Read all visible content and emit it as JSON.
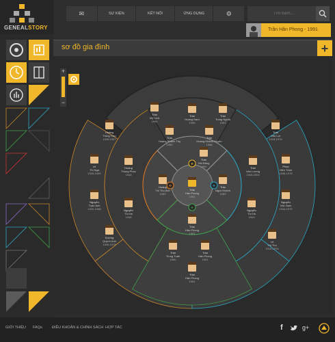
{
  "logo": {
    "part1": "GENEAL",
    "part2": "STORY"
  },
  "nav": {
    "mail_icon": "mail-icon",
    "items": [
      "SỰ KIỆN",
      "KẾT NỐI",
      "ỨNG DỤNG"
    ],
    "settings_icon": "gear-icon"
  },
  "search": {
    "placeholder": "Tìm kiếm..."
  },
  "user": {
    "name": "Trần Hân Phong - 1991"
  },
  "page": {
    "title": "sơ đồ gia đình",
    "add_label": "+"
  },
  "zoom": {
    "plus": "+",
    "minus": "−"
  },
  "tree": {
    "people": [
      {
        "id": "p1",
        "name": "Trần",
        "sub": "Mỹ Linh",
        "years": "1994"
      },
      {
        "id": "p2",
        "name": "Trần",
        "sub": "Hoàng Nam",
        "years": "1990"
      },
      {
        "id": "p3",
        "name": "Trần",
        "sub": "Trọng Nghĩa",
        "years": "1993"
      },
      {
        "id": "p4",
        "name": "Trần",
        "sub": "Hoàng Khánh Thy",
        "years": "1989"
      },
      {
        "id": "p5",
        "name": "Trần",
        "sub": "Hoàng Khánh Huyền",
        "years": "1988"
      },
      {
        "id": "p6",
        "name": "Trần",
        "sub": "Hải Đăng",
        "years": "1990"
      },
      {
        "id": "p7",
        "name": "Hoàng",
        "sub": "Trùng Trần",
        "years": "1928-1907"
      },
      {
        "id": "p8",
        "name": "Hoàng",
        "sub": "Thùng Phúc",
        "years": "1948"
      },
      {
        "id": "p9",
        "name": "Hoàng",
        "sub": "Thị Thu Anh",
        "years": "1969"
      },
      {
        "id": "p10",
        "name": "Trần",
        "sub": "Hân Phong",
        "years": "1991"
      },
      {
        "id": "p11",
        "name": "Trần",
        "sub": "Ngọc Khánh",
        "years": "1969"
      },
      {
        "id": "p12",
        "name": "Trần",
        "sub": "Văn Lương",
        "years": "1940-2004"
      },
      {
        "id": "p13",
        "name": "Trần",
        "sub": "Văn Lợi",
        "years": "1918-1976"
      },
      {
        "id": "p14",
        "name": "Lê",
        "sub": "Thị Nga",
        "years": "1926-1990"
      },
      {
        "id": "p15",
        "name": "Phan",
        "sub": "Hiếu Trâm",
        "years": "1938-1978"
      },
      {
        "id": "p16",
        "name": "Nguyễn",
        "sub": "Tuấn Anh",
        "years": "1920-1988"
      },
      {
        "id": "p17",
        "name": "Nguyễn",
        "sub": "Thị Hà",
        "years": "1946"
      },
      {
        "id": "p18",
        "name": "Trần",
        "sub": "Hân Phong",
        "years": "1991"
      },
      {
        "id": "p19",
        "name": "Nguyễn",
        "sub": "Thị Hà",
        "years": "1943"
      },
      {
        "id": "p20",
        "name": "Nguyễn",
        "sub": "Văn Nam",
        "years": "1918-1979"
      },
      {
        "id": "p21",
        "name": "Dương",
        "sub": "Quỳnh Anh",
        "years": "1926-1978"
      },
      {
        "id": "p22",
        "name": "Trần",
        "sub": "Trung Tuấn",
        "years": "1990"
      },
      {
        "id": "p23",
        "name": "Trần",
        "sub": "Hân Phong",
        "years": "1991"
      },
      {
        "id": "p24",
        "name": "Lê",
        "sub": "Thị Thu",
        "years": "1915-1976"
      },
      {
        "id": "p25",
        "name": "Trần",
        "sub": "Hân Phong",
        "years": "1991"
      }
    ]
  },
  "footer": {
    "links": [
      "GIỚI THIỆU",
      "FAQs",
      "ĐIỀU KHOẢN & CHÍNH SÁCH",
      "HỢP TÁC"
    ],
    "social": [
      "f",
      "twitter",
      "g+"
    ]
  },
  "colors": {
    "accent": "#f1b72a",
    "orange": "#e07a22",
    "teal": "#2aa6c4",
    "green": "#3fa24a"
  }
}
